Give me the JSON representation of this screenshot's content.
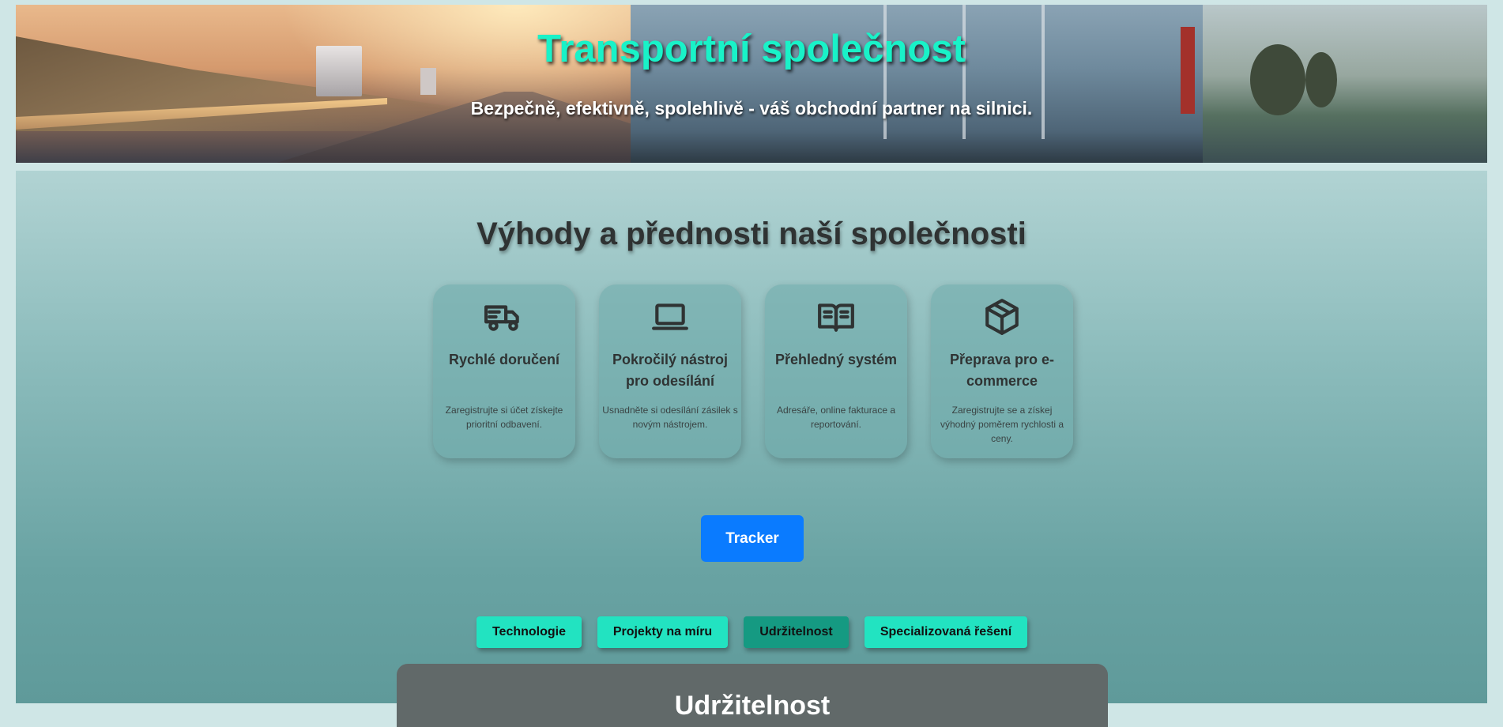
{
  "hero": {
    "title": "Transportní společnost",
    "subtitle": "Bezpečně, efektivně, spolehlivě - váš obchodní partner na silnici."
  },
  "benefits": {
    "heading": "Výhody a přednosti naší společnosti",
    "items": [
      {
        "icon": "truck-icon",
        "title": "Rychlé doručení",
        "description": "Zaregistrujte si účet získejte prioritní odbavení."
      },
      {
        "icon": "laptop-icon",
        "title": "Pokročilý nástroj pro odesílání",
        "description": "Usnadněte si odesílání zásilek s novým nástrojem."
      },
      {
        "icon": "book-icon",
        "title": "Přehledný systém",
        "description": "Adresáře, online fakturace a reportování."
      },
      {
        "icon": "package-icon",
        "title": "Přeprava pro e-commerce",
        "description": "Zaregistrujte se a získej výhodný poměrem rychlosti a ceny."
      }
    ]
  },
  "tracker": {
    "label": "Tracker"
  },
  "tabs": [
    {
      "label": "Technologie",
      "active": false
    },
    {
      "label": "Projekty na míru",
      "active": false
    },
    {
      "label": "Udržitelnost",
      "active": true
    },
    {
      "label": "Specializovaná řešení",
      "active": false
    }
  ],
  "panel": {
    "title": "Udržitelnost"
  },
  "colors": {
    "accent": "#19f2c8",
    "tab": "#22e3c1",
    "tab_active": "#159a82",
    "button": "#0a7bff"
  }
}
